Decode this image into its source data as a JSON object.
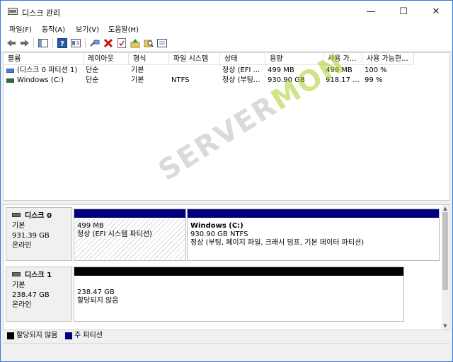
{
  "window": {
    "title": "디스크 관리",
    "controls": {
      "minimize": "—",
      "maximize": "☐",
      "close": "✕"
    }
  },
  "menu": [
    "파일(F)",
    "동작(A)",
    "보기(V)",
    "도움말(H)"
  ],
  "toolbar": {
    "icons": [
      "back-arrow-icon",
      "forward-arrow-icon",
      "console-tree-icon",
      "help-icon",
      "properties-icon",
      "connect-icon",
      "delete-icon",
      "check-icon",
      "up-icon",
      "search-folder-icon",
      "settings-icon"
    ]
  },
  "volume_table": {
    "columns": [
      "볼륨",
      "레이아웃",
      "형식",
      "파일 시스템",
      "상태",
      "용량",
      "사용 가...",
      "사용 가능한..."
    ],
    "rows": [
      {
        "volume": "(디스크 0 파티션 1)",
        "layout": "단순",
        "type": "기본",
        "fs": "",
        "status": "정상 (EFI ...",
        "capacity": "499 MB",
        "free": "499 MB",
        "free_pct": "100 %"
      },
      {
        "volume": "Windows (C:)",
        "layout": "단순",
        "type": "기본",
        "fs": "NTFS",
        "status": "정상 (부팅...",
        "capacity": "930.90 GB",
        "free": "918.17 ...",
        "free_pct": "99 %"
      }
    ]
  },
  "disks": [
    {
      "name": "디스크 0",
      "type": "기본",
      "size": "931.39 GB",
      "state": "온라인",
      "partitions": [
        {
          "title": "",
          "size": "499 MB",
          "status": "정상 (EFI 시스템 파티션)"
        },
        {
          "title": "Windows  (C:)",
          "size": "930.90 GB NTFS",
          "status": "정상 (부팅, 페이지 파일, 크래시 덤프, 기본 데이터 파티션)"
        }
      ]
    },
    {
      "name": "디스크 1",
      "type": "기본",
      "size": "238.47 GB",
      "state": "온라인",
      "partitions": [
        {
          "title": "",
          "size": "238.47 GB",
          "status": "할당되지 않음"
        }
      ]
    }
  ],
  "legend": [
    {
      "label": "할당되지 않음",
      "color": "#000000"
    },
    {
      "label": "주 파티션",
      "color": "#00007f"
    }
  ],
  "colors": {
    "primary_bar": "#00007f",
    "unallocated_bar": "#000000"
  },
  "watermark": {
    "part1": "SERVER",
    "part2": "MON"
  }
}
